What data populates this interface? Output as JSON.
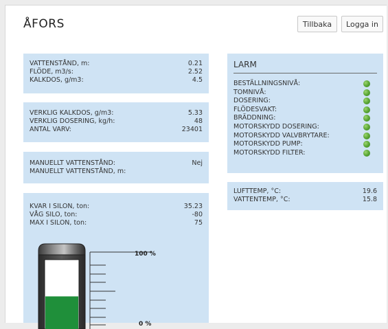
{
  "header": {
    "title": "ÅFORS",
    "back_label": "Tillbaka",
    "login_label": "Logga in"
  },
  "flow_panel": {
    "rows": [
      {
        "label": "VATTENSTÅND, m:",
        "value": "0.21"
      },
      {
        "label": "FLÖDE, m3/s:",
        "value": "2.52"
      },
      {
        "label": "KALKDOS, g/m3:",
        "value": "4.5"
      }
    ]
  },
  "dosing_panel": {
    "rows": [
      {
        "label": "VERKLIG KALKDOS, g/m3:",
        "value": "5.33"
      },
      {
        "label": "VERKLIG DOSERING, kg/h:",
        "value": "48"
      },
      {
        "label": "ANTAL VARV:",
        "value": "23401"
      }
    ]
  },
  "manual_panel": {
    "rows": [
      {
        "label": "MANUELLT VATTENSTÅND:",
        "value": "Nej"
      },
      {
        "label": "MANUELLT VATTENSTÅND, m:",
        "value": ""
      }
    ]
  },
  "silo_panel": {
    "rows": [
      {
        "label": "KVAR I SILON, ton:",
        "value": "35.23"
      },
      {
        "label": "VÅG SILO, ton:",
        "value": "-80"
      },
      {
        "label": "MAX I SILON, ton:",
        "value": "75"
      }
    ],
    "level_top_label": "100 %",
    "level_bottom_label": "0 %",
    "fill_fraction": 0.47,
    "fill_color": "#1f8f3a"
  },
  "alarm_panel": {
    "title": "LARM",
    "items": [
      {
        "label": "BESTÄLLNINGSNIVÅ:",
        "status": "ok"
      },
      {
        "label": "TOMNIVÅ:",
        "status": "ok"
      },
      {
        "label": "DOSERING:",
        "status": "ok"
      },
      {
        "label": "FLÖDESVAKT:",
        "status": "ok"
      },
      {
        "label": "BRÄDDNING:",
        "status": "ok"
      },
      {
        "label": "MOTORSKYDD DOSERING:",
        "status": "ok"
      },
      {
        "label": "MOTORSKYDD VALVBRYTARE:",
        "status": "ok"
      },
      {
        "label": "MOTORSKYDD PUMP:",
        "status": "ok"
      },
      {
        "label": "MOTORSKYDD FILTER:",
        "status": "ok"
      }
    ],
    "ok_color": "#55a232"
  },
  "temp_panel": {
    "rows": [
      {
        "label": "LUFTTEMP, °C:",
        "value": "19.6"
      },
      {
        "label": "VATTENTEMP, °C:",
        "value": "15.8"
      }
    ]
  }
}
